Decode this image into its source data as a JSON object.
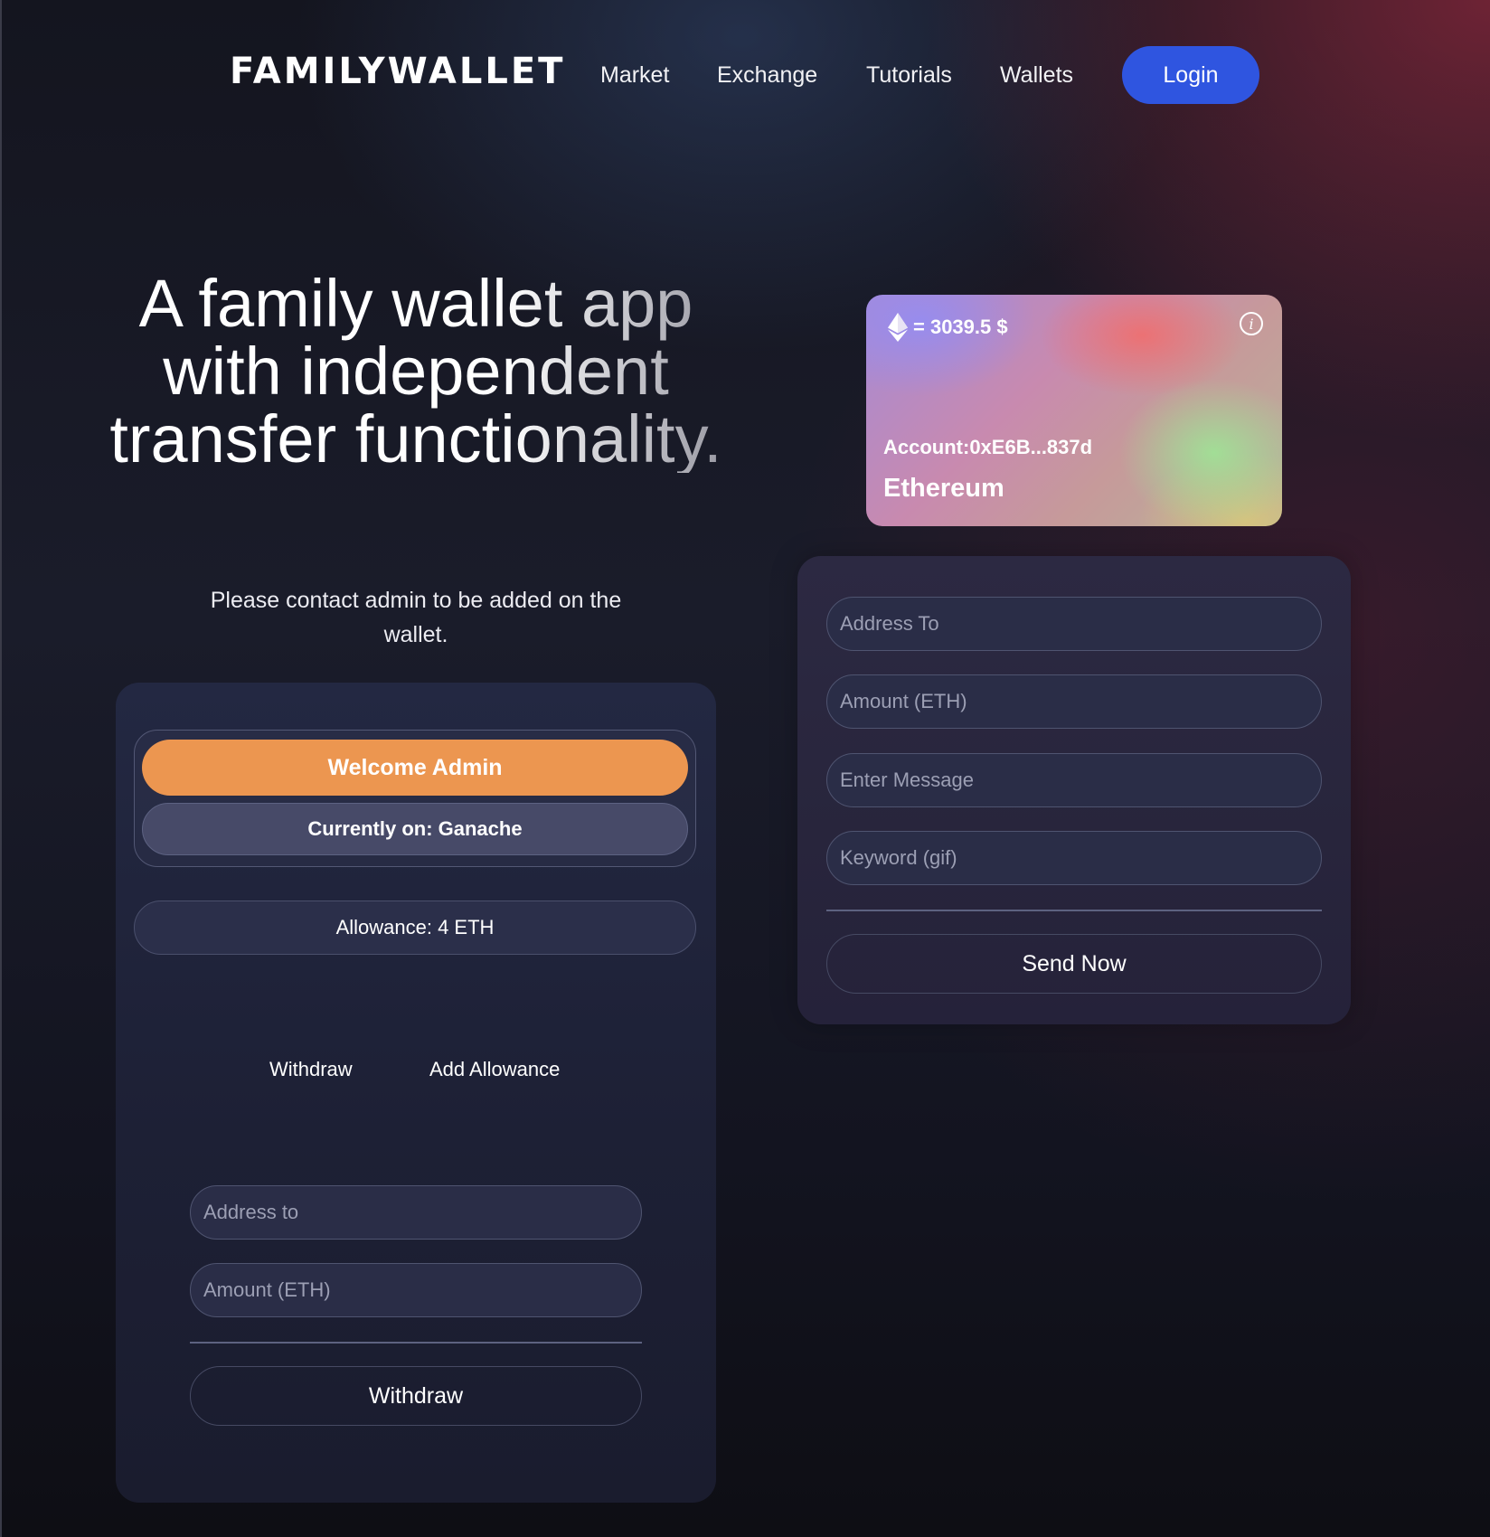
{
  "nav": {
    "logo": "FAMILYWALLET",
    "links": [
      "Market",
      "Exchange",
      "Tutorials",
      "Wallets"
    ],
    "login": "Login"
  },
  "hero": {
    "title": "A family wallet app with independent transfer functionality.",
    "subtitle": "Please contact admin to be added on the wallet."
  },
  "admin_panel": {
    "welcome": "Welcome Admin",
    "network": "Currently on: Ganache",
    "allowance": "Allowance: 4 ETH",
    "tabs": [
      "Withdraw",
      "Add Allowance"
    ],
    "address_placeholder": "Address to",
    "amount_placeholder": "Amount (ETH)",
    "submit": "Withdraw"
  },
  "eth_card": {
    "price": "= 3039.5 $",
    "account": "Account:0xE6B...837d",
    "network": "Ethereum",
    "info_glyph": "i"
  },
  "send_form": {
    "address_placeholder": "Address To",
    "amount_placeholder": "Amount (ETH)",
    "message_placeholder": "Enter Message",
    "keyword_placeholder": "Keyword (gif)",
    "submit": "Send Now"
  },
  "colors": {
    "login_blue": "#2f55e0",
    "welcome_orange": "#ec9650"
  },
  "icons": {
    "eth": "ethereum-icon",
    "info": "info-icon"
  }
}
